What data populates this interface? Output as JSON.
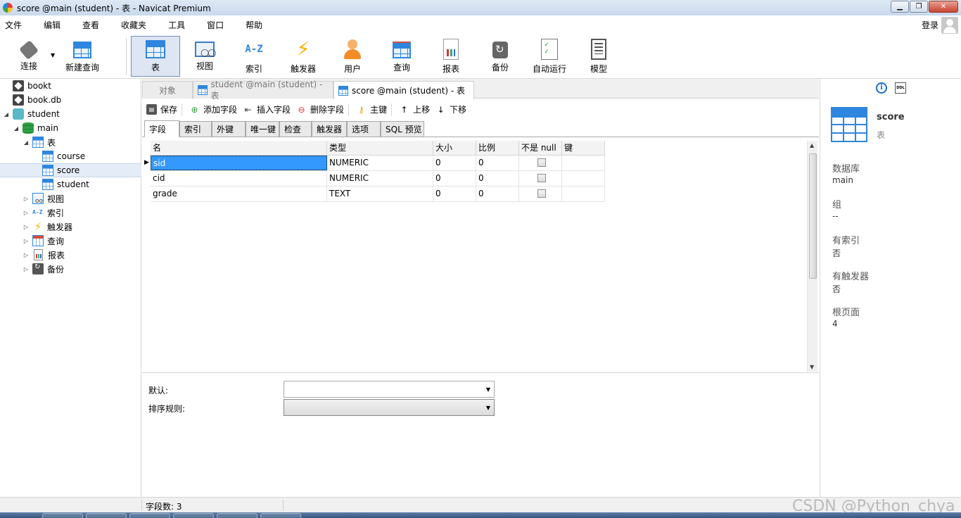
{
  "window": {
    "title": "score @main (student) - 表 - Navicat Premium",
    "close_glyph": "✕",
    "min_glyph": "▁",
    "max_glyph": "❐"
  },
  "menu": [
    "文件",
    "编辑",
    "查看",
    "收藏夹",
    "工具",
    "窗口",
    "帮助"
  ],
  "login_label": "登录",
  "toolbar": [
    {
      "label": "连接",
      "icon": "plug-icon"
    },
    {
      "label": "新建查询",
      "icon": "new-query-icon"
    },
    {
      "label": "表",
      "icon": "table-icon",
      "active": true
    },
    {
      "label": "视图",
      "icon": "view-icon"
    },
    {
      "label": "索引",
      "icon": "index-icon",
      "glyph": "A-Z"
    },
    {
      "label": "触发器",
      "icon": "trigger-icon",
      "glyph": "⚡"
    },
    {
      "label": "用户",
      "icon": "user-icon"
    },
    {
      "label": "查询",
      "icon": "query-icon"
    },
    {
      "label": "报表",
      "icon": "report-icon"
    },
    {
      "label": "备份",
      "icon": "backup-icon"
    },
    {
      "label": "自动运行",
      "icon": "automation-icon"
    },
    {
      "label": "模型",
      "icon": "model-icon"
    }
  ],
  "nav_tree": [
    {
      "label": "bookt",
      "icon": "sqlite-db-icon"
    },
    {
      "label": "book.db",
      "icon": "sqlite-db-icon"
    },
    {
      "label": "student",
      "icon": "sqlite-connection-icon",
      "arrow": "◢"
    },
    {
      "label": "main",
      "icon": "database-icon",
      "arrow": "◢"
    },
    {
      "label": "表",
      "icon": "table-folder-icon",
      "arrow": "◢"
    },
    {
      "label": "course",
      "icon": "table-icon"
    },
    {
      "label": "score",
      "icon": "table-icon",
      "selected": true
    },
    {
      "label": "student",
      "icon": "table-icon"
    },
    {
      "label": "视图",
      "icon": "view-icon",
      "arrow": "▷"
    },
    {
      "label": "索引",
      "icon": "index-icon",
      "arrow": "▷",
      "glyph": "A-Z"
    },
    {
      "label": "触发器",
      "icon": "trigger-icon",
      "arrow": "▷",
      "glyph": "⚡"
    },
    {
      "label": "查询",
      "icon": "query-icon",
      "arrow": "▷"
    },
    {
      "label": "报表",
      "icon": "report-icon",
      "arrow": "▷"
    },
    {
      "label": "备份",
      "icon": "backup-icon",
      "arrow": "▷"
    }
  ],
  "doc_tabs": [
    {
      "label": "对象"
    },
    {
      "label": "student @main (student) - 表"
    },
    {
      "label": "score @main (student) - 表",
      "active": true
    }
  ],
  "editor_toolbar": [
    {
      "label": "保存",
      "icon": "save-icon",
      "glyph": "💾"
    },
    {
      "label": "添加字段",
      "icon": "add-field-icon",
      "glyph": "⊕"
    },
    {
      "label": "插入字段",
      "icon": "insert-field-icon",
      "glyph": "⇤"
    },
    {
      "label": "删除字段",
      "icon": "delete-field-icon",
      "glyph": "⊖"
    },
    {
      "label": "主键",
      "icon": "key-icon",
      "glyph": "🔑"
    },
    {
      "label": "上移",
      "icon": "arrow-up-icon",
      "glyph": "↑"
    },
    {
      "label": "下移",
      "icon": "arrow-down-icon",
      "glyph": "↓"
    }
  ],
  "sub_tabs": [
    "字段",
    "索引",
    "外键",
    "唯一键",
    "检查",
    "触发器",
    "选项",
    "SQL 预览"
  ],
  "grid": {
    "columns": [
      "名",
      "类型",
      "大小",
      "比例",
      "不是 null",
      "键"
    ],
    "rows": [
      {
        "name": "sid",
        "type": "NUMERIC",
        "size": "0",
        "scale": "0",
        "not_null": false,
        "key": ""
      },
      {
        "name": "cid",
        "type": "NUMERIC",
        "size": "0",
        "scale": "0",
        "not_null": false,
        "key": ""
      },
      {
        "name": "grade",
        "type": "TEXT",
        "size": "0",
        "scale": "0",
        "not_null": false,
        "key": ""
      }
    ],
    "current_row_marker": "▶"
  },
  "props": {
    "default_label": "默认:",
    "collation_label": "排序规则:",
    "caret": "▼"
  },
  "info": {
    "name": "score",
    "type": "表",
    "fields": [
      {
        "label": "数据库",
        "value": "main"
      },
      {
        "label": "组",
        "value": "--"
      },
      {
        "label": "有索引",
        "value": "否"
      },
      {
        "label": "有触发器",
        "value": "否"
      },
      {
        "label": "根页面",
        "value": "4"
      }
    ],
    "info_glyph": "i",
    "ddl_glyph": "DDL"
  },
  "status": {
    "field_count": "字段数: 3"
  },
  "watermark": "CSDN @Python_chya",
  "scroll": {
    "up": "▲",
    "down": "▼"
  }
}
